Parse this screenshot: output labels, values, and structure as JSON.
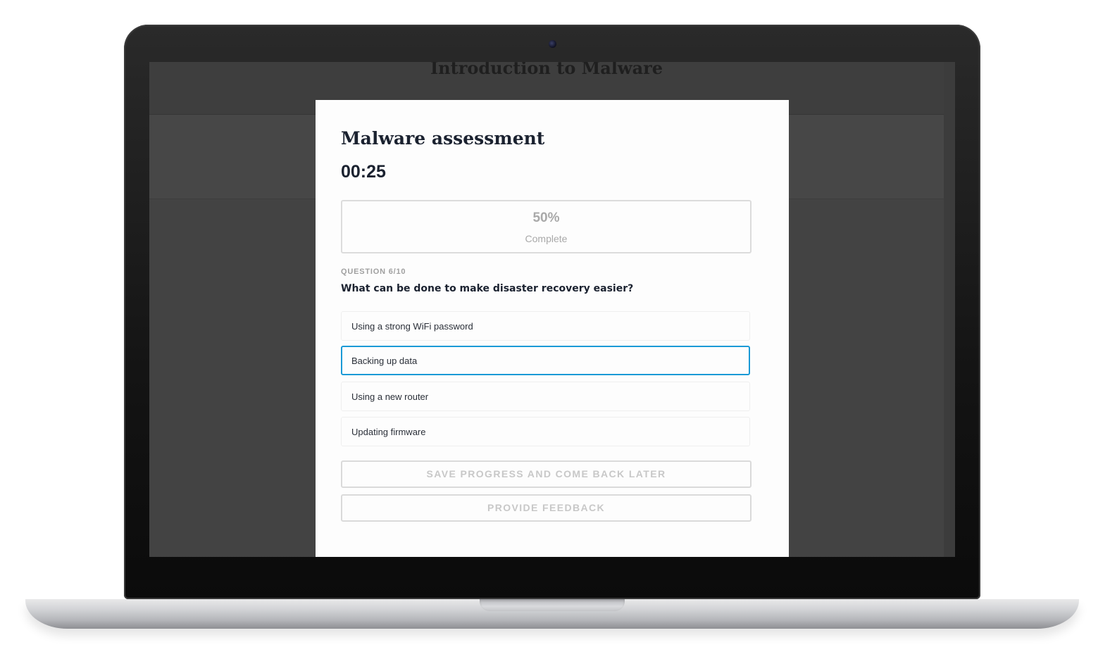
{
  "course": {
    "title": "Introduction to Malware"
  },
  "modal": {
    "title": "Malware assessment",
    "timer": "00:25",
    "progress": {
      "percent_text": "50%",
      "percent_value": 50,
      "label": "Complete"
    },
    "question": {
      "number": "QUESTION 6/10",
      "text": "What can be done to make disaster recovery easier?",
      "options": [
        {
          "label": "Using a strong WiFi password",
          "selected": false
        },
        {
          "label": "Backing up data",
          "selected": true
        },
        {
          "label": "Using a new router",
          "selected": false
        },
        {
          "label": "Updating firmware",
          "selected": false
        }
      ]
    },
    "buttons": {
      "save_label": "SAVE PROGRESS AND COME BACK LATER",
      "feedback_label": "PROVIDE FEEDBACK"
    }
  },
  "colors": {
    "selected_border": "#1a9ad6",
    "overlay": "#434343",
    "text_dark": "#1b2230"
  }
}
